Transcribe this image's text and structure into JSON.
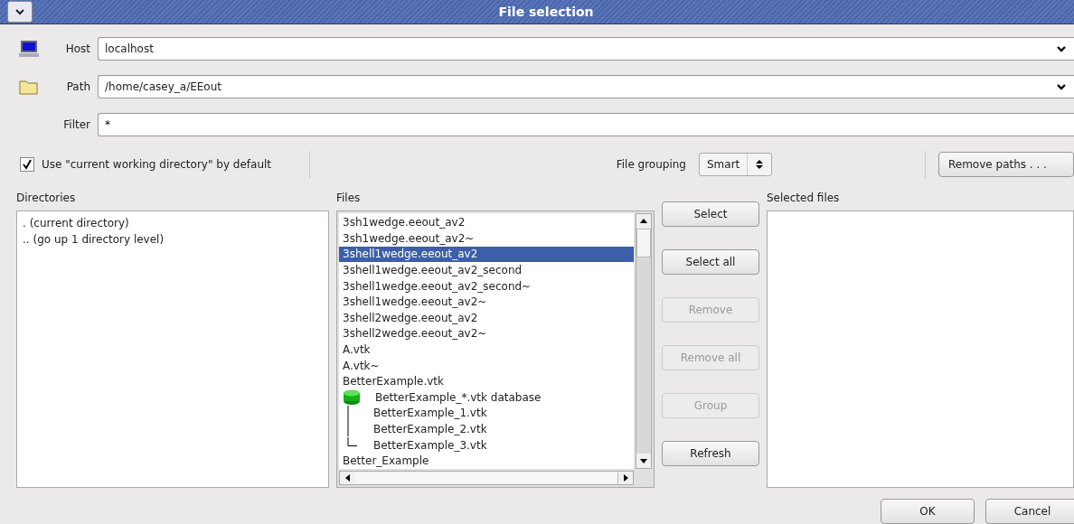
{
  "window": {
    "title": "File selection"
  },
  "host": {
    "label": "Host",
    "value": "localhost"
  },
  "path": {
    "label": "Path",
    "value": "/home/casey_a/EEout"
  },
  "filter": {
    "label": "Filter",
    "value": "*"
  },
  "use_cwd": {
    "label": "Use \"current working directory\" by default",
    "checked": true
  },
  "file_grouping": {
    "label": "File grouping",
    "value": "Smart"
  },
  "remove_paths_button": "Remove paths . . .",
  "directories": {
    "label": "Directories",
    "items": [
      ". (current directory)",
      ".. (go up 1 directory level)"
    ]
  },
  "files": {
    "label": "Files",
    "items": [
      {
        "kind": "file",
        "name": "3sh1wedge.eeout_av2",
        "selected": false
      },
      {
        "kind": "file",
        "name": "3sh1wedge.eeout_av2~",
        "selected": false
      },
      {
        "kind": "file",
        "name": "3shell1wedge.eeout_av2",
        "selected": true
      },
      {
        "kind": "file",
        "name": "3shell1wedge.eeout_av2_second",
        "selected": false
      },
      {
        "kind": "file",
        "name": "3shell1wedge.eeout_av2_second~",
        "selected": false
      },
      {
        "kind": "file",
        "name": "3shell1wedge.eeout_av2~",
        "selected": false
      },
      {
        "kind": "file",
        "name": "3shell2wedge.eeout_av2",
        "selected": false
      },
      {
        "kind": "file",
        "name": "3shell2wedge.eeout_av2~",
        "selected": false
      },
      {
        "kind": "file",
        "name": "A.vtk",
        "selected": false
      },
      {
        "kind": "file",
        "name": "A.vtk~",
        "selected": false
      },
      {
        "kind": "file",
        "name": "BetterExample.vtk",
        "selected": false
      },
      {
        "kind": "database",
        "name": "BetterExample_*.vtk database",
        "selected": false,
        "children": [
          {
            "name": "BetterExample_1.vtk",
            "selected": false
          },
          {
            "name": "BetterExample_2.vtk",
            "selected": false
          },
          {
            "name": "BetterExample_3.vtk",
            "selected": false
          }
        ]
      },
      {
        "kind": "file",
        "name": "Better_Example",
        "selected": false
      }
    ]
  },
  "actions": [
    {
      "label": "Select",
      "disabled": false
    },
    {
      "label": "Select all",
      "disabled": false
    },
    {
      "label": "Remove",
      "disabled": true
    },
    {
      "label": "Remove all",
      "disabled": true
    },
    {
      "label": "Group",
      "disabled": true
    },
    {
      "label": "Refresh",
      "disabled": false
    }
  ],
  "selected_files": {
    "label": "Selected files"
  },
  "buttons": [
    "OK",
    "Cancel"
  ]
}
